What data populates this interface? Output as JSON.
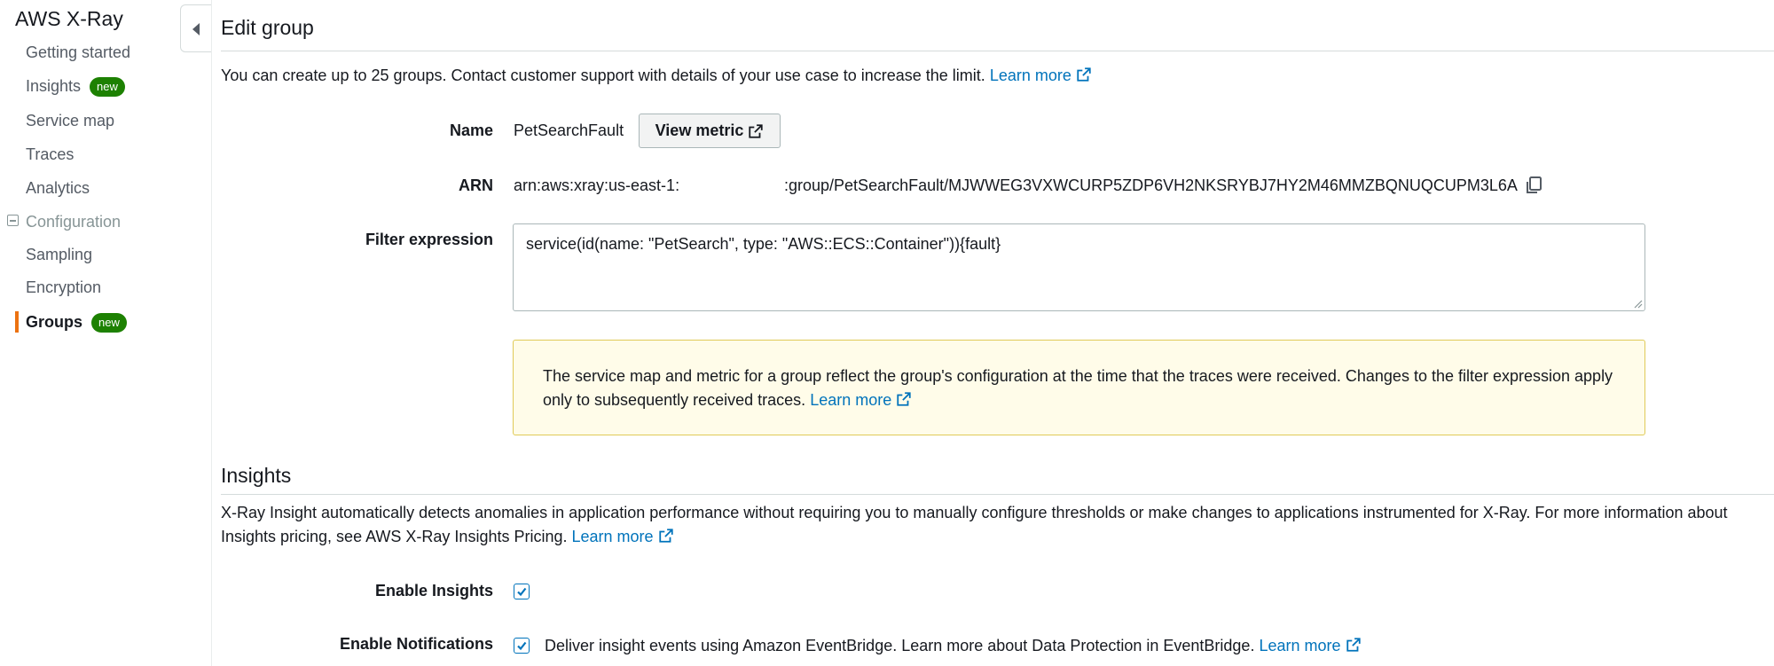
{
  "sidebar": {
    "title": "AWS X-Ray",
    "items": [
      {
        "label": "Getting started"
      },
      {
        "label": "Insights",
        "badge": "new"
      },
      {
        "label": "Service map"
      },
      {
        "label": "Traces"
      },
      {
        "label": "Analytics"
      }
    ],
    "configuration": {
      "label": "Configuration",
      "items": [
        {
          "label": "Sampling"
        },
        {
          "label": "Encryption"
        },
        {
          "label": "Groups",
          "badge": "new",
          "active": true
        }
      ]
    }
  },
  "edit_group": {
    "title": "Edit group",
    "description": "You can create up to 25 groups. Contact customer support with details of your use case to increase the limit.",
    "learn_more": "Learn more",
    "name_label": "Name",
    "name_value": "PetSearchFault",
    "view_metric_label": "View metric",
    "arn_label": "ARN",
    "arn_prefix": "arn:aws:xray:us-east-1:",
    "arn_suffix": ":group/PetSearchFault/MJWWEG3VXWCURP5ZDP6VH2NKSRYBJ7HY2M46MMZBQNUQCUPM3L6A",
    "filter_label": "Filter expression",
    "filter_value": "service(id(name: \"PetSearch\", type: \"AWS::ECS::Container\")){fault}",
    "alert_text": "The service map and metric for a group reflect the group's configuration at the time that the traces were received. Changes to the filter expression apply only to subsequently received traces.",
    "alert_learn_more": "Learn more"
  },
  "insights": {
    "title": "Insights",
    "description": "X-Ray Insight automatically detects anomalies in application performance without requiring you to manually configure thresholds or make changes to applications instrumented for X-Ray. For more information about Insights pricing, see AWS X-Ray Insights Pricing.",
    "learn_more": "Learn more",
    "enable_insights_label": "Enable Insights",
    "enable_insights_checked": true,
    "enable_notifications_label": "Enable Notifications",
    "enable_notifications_checked": true,
    "notifications_text": "Deliver insight events using Amazon EventBridge. Learn more about Data Protection in EventBridge.",
    "notifications_learn_more": "Learn more"
  },
  "colors": {
    "link": "#0073bb",
    "badge": "#1d8102",
    "active_indicator": "#ec7211",
    "alert_border": "#e0ca57",
    "alert_bg": "#fffce9"
  },
  "icons": [
    "collapse-arrow-icon",
    "external-link-icon",
    "copy-icon",
    "checkmark-icon",
    "resize-grip-icon"
  ]
}
